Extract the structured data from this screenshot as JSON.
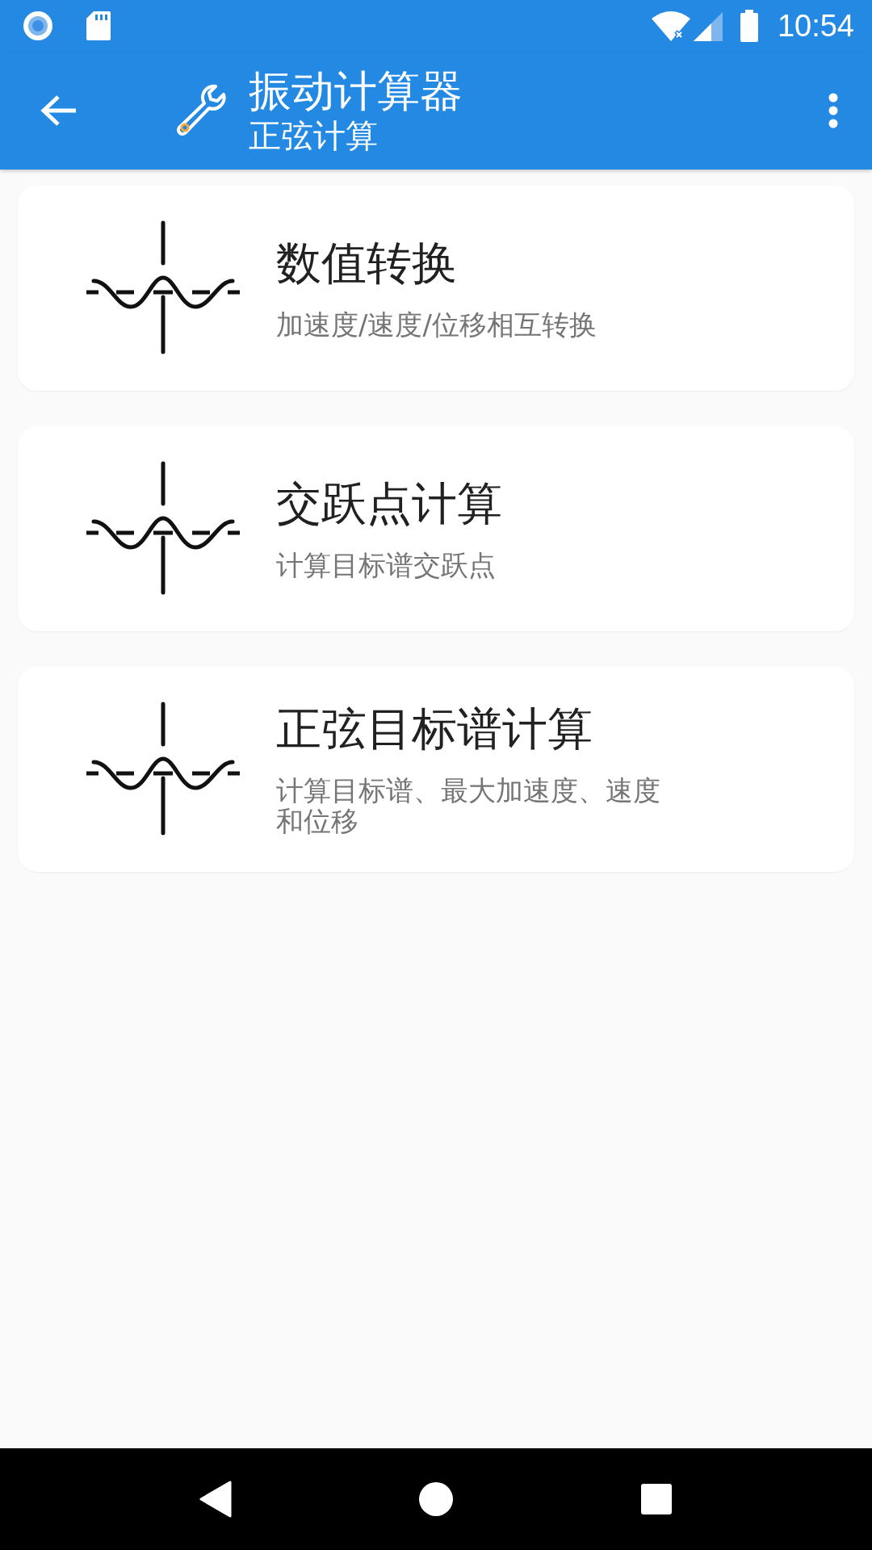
{
  "status_bar": {
    "time": "10:54"
  },
  "app_bar": {
    "title": "振动计算器",
    "subtitle": "正弦计算"
  },
  "cards": [
    {
      "title": "数值转换",
      "subtitle": "加速度/速度/位移相互转换"
    },
    {
      "title": "交跃点计算",
      "subtitle": "计算目标谱交跃点"
    },
    {
      "title": "正弦目标谱计算",
      "subtitle": "计算目标谱、最大加速度、速度和位移"
    }
  ]
}
